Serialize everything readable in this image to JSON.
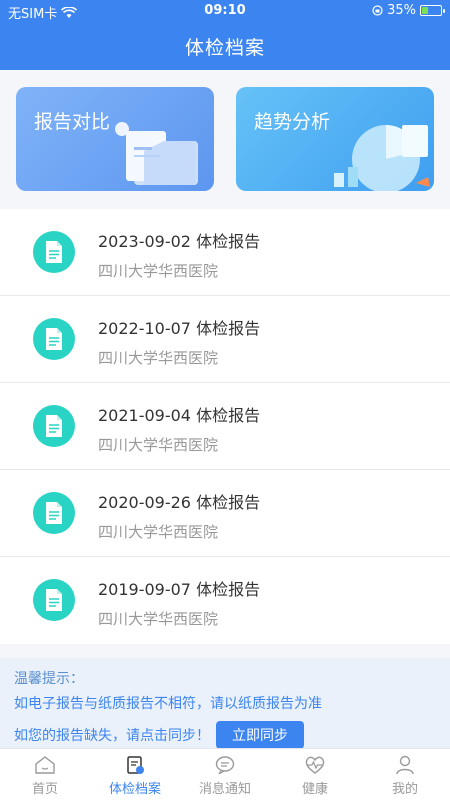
{
  "status": {
    "carrier": "无SIM卡",
    "time": "09:10",
    "battery": "35%",
    "battery_level": 0.35
  },
  "header": {
    "title": "体检档案"
  },
  "cards": [
    {
      "label": "报告对比",
      "icon": "folder-icon"
    },
    {
      "label": "趋势分析",
      "icon": "pie-chart-icon"
    }
  ],
  "reports": [
    {
      "name": "2023-09-02 体检报告",
      "hospital": "四川大学华西医院"
    },
    {
      "name": "2022-10-07 体检报告",
      "hospital": "四川大学华西医院"
    },
    {
      "name": "2021-09-04 体检报告",
      "hospital": "四川大学华西医院"
    },
    {
      "name": "2020-09-26 体检报告",
      "hospital": "四川大学华西医院"
    },
    {
      "name": "2019-09-07 体检报告",
      "hospital": "四川大学华西医院"
    }
  ],
  "tip": {
    "title": "温馨提示：",
    "line1": "如电子报告与纸质报告不相符，请以纸质报告为准",
    "line2": "如您的报告缺失，请点击同步！",
    "sync_label": "立即同步"
  },
  "tabs": [
    {
      "label": "首页",
      "icon": "home-icon"
    },
    {
      "label": "体检档案",
      "icon": "archive-icon",
      "active": true
    },
    {
      "label": "消息通知",
      "icon": "message-icon"
    },
    {
      "label": "健康",
      "icon": "heart-icon"
    },
    {
      "label": "我的",
      "icon": "user-icon"
    }
  ],
  "colors": {
    "primary": "#3c85f0",
    "doc_icon": "#2ad4c4"
  }
}
